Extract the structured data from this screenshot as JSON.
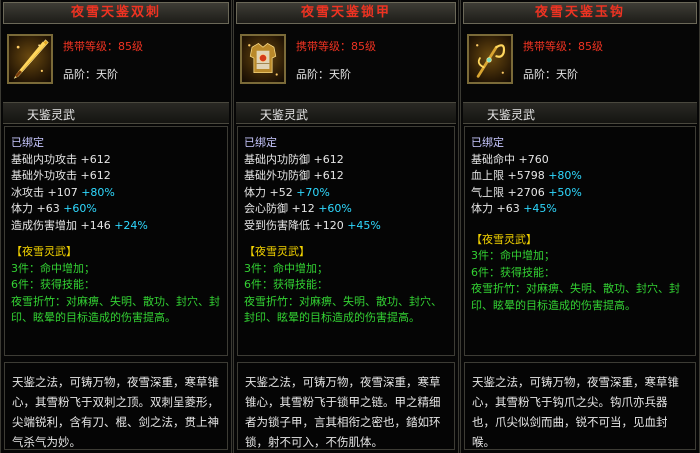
{
  "cards": [
    {
      "title": "夜雪天鉴双刺",
      "item_icon": "twin-blade-weapon-icon",
      "req_label": "携带等级：",
      "req_value": "85级",
      "rank_label": "品阶：",
      "rank_value": "天阶",
      "category": "天鉴灵武",
      "bound": "已绑定",
      "stats": [
        {
          "name": "基础内功攻击",
          "base": "+612",
          "bonus": ""
        },
        {
          "name": "基础外功攻击",
          "base": "+612",
          "bonus": ""
        },
        {
          "name": "冰攻击",
          "base": "+107",
          "bonus": "+80%"
        },
        {
          "name": "体力",
          "base": "+63",
          "bonus": "+60%"
        },
        {
          "name": "造成伤害增加",
          "base": "+146",
          "bonus": "+24%"
        }
      ],
      "set_name": "【夜雪灵武】",
      "set_lines": [
        "3件：命中增加；",
        "6件：获得技能：",
        "夜雪折竹：对麻痹、失明、散功、封穴、封印、眩晕的目标造成的伤害提高。"
      ],
      "description": "天鉴之法，可铸万物，夜雪深重，寒草锥心，其雪粉飞于双刺之顶。双刺呈菱形，尖端锐利，含有刀、棍、剑之法，贯上神气杀气为妙。"
    },
    {
      "title": "夜雪天鉴锁甲",
      "item_icon": "armor-chestplate-icon",
      "req_label": "携带等级：",
      "req_value": "85级",
      "rank_label": "品阶：",
      "rank_value": "天阶",
      "category": "天鉴灵武",
      "bound": "已绑定",
      "stats": [
        {
          "name": "基础内功防御",
          "base": "+612",
          "bonus": ""
        },
        {
          "name": "基础外功防御",
          "base": "+612",
          "bonus": ""
        },
        {
          "name": "体力",
          "base": "+52",
          "bonus": "+70%"
        },
        {
          "name": "会心防御",
          "base": "+12",
          "bonus": "+60%"
        },
        {
          "name": "受到伤害降低",
          "base": "+120",
          "bonus": "+45%"
        }
      ],
      "set_name": "【夜雪灵武】",
      "set_lines": [
        "3件：命中增加；",
        "6件：获得技能：",
        "夜雪折竹：对麻痹、失明、散功、封穴、封印、眩晕的目标造成的伤害提高。"
      ],
      "description": "天鉴之法，可铸万物，夜雪深重，寒草锥心，其雪粉飞于锁甲之链。甲之精细者为锁子甲，言其相衔之密也，錔如环锁，射不可入，不伤肌体。"
    },
    {
      "title": "夜雪天鉴玉钩",
      "item_icon": "jade-hook-weapon-icon",
      "req_label": "携带等级：",
      "req_value": "85级",
      "rank_label": "品阶：",
      "rank_value": "天阶",
      "category": "天鉴灵武",
      "bound": "已绑定",
      "stats": [
        {
          "name": "基础命中",
          "base": "+760",
          "bonus": ""
        },
        {
          "name": "血上限",
          "base": "+5798",
          "bonus": "+80%"
        },
        {
          "name": "气上限",
          "base": "+2706",
          "bonus": "+50%"
        },
        {
          "name": "体力",
          "base": "+63",
          "bonus": "+45%"
        }
      ],
      "set_name": "【夜雪灵武】",
      "set_lines": [
        "3件：命中增加；",
        "6件：获得技能：",
        "夜雪折竹：对麻痹、失明、散功、封穴、封印、眩晕的目标造成的伤害提高。"
      ],
      "description": "天鉴之法，可铸万物，夜雪深重，寒草锥心，其雪粉飞于钩爪之尖。钩爪亦兵器也，爪尖似剑而曲，锐不可当，见血封喉。"
    }
  ]
}
